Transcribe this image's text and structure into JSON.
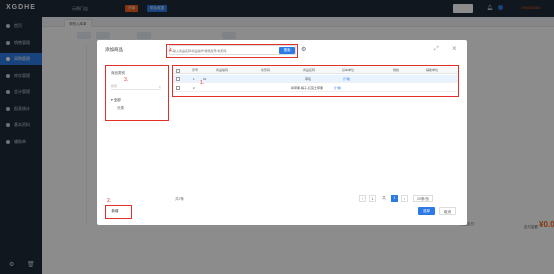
{
  "topbar": {
    "logo": "XGDHE",
    "store": "示例门店",
    "btn_orange": "开单",
    "btn_blue": "前台收银",
    "phone": "1994010000"
  },
  "sidebar": {
    "items": [
      {
        "label": "首页"
      },
      {
        "label": "销售管理"
      },
      {
        "label": "采购管理"
      },
      {
        "label": "库存管理"
      },
      {
        "label": "会计管理"
      },
      {
        "label": "报表统计"
      },
      {
        "label": "基本资料"
      },
      {
        "label": "辅助单"
      }
    ],
    "active_index": 2
  },
  "background": {
    "tab": "采购入库单",
    "total_label": "应付金额",
    "total_value": "¥0.00",
    "cash_label": "现金支付"
  },
  "modal": {
    "title": "添加商品",
    "search_placeholder": "输入商品名称/商品编号/规格型号/条形码",
    "search_button": "搜索",
    "category": {
      "title": "商品类别",
      "search_placeholder": "搜索",
      "root": "全部",
      "child": "分类"
    },
    "table": {
      "headers": [
        "序号",
        "商品编码",
        "条形码",
        "商品名称",
        "基本单位",
        "规格",
        "辅助单位"
      ],
      "rows": [
        {
          "index": "1",
          "code": "01",
          "barcode": "",
          "name": "草莓",
          "unit": "斤/箱",
          "spec": "",
          "aux_unit": ""
        },
        {
          "index": "2",
          "code": "",
          "barcode": "",
          "name": "青苹果-橘子-红富士苹果",
          "unit": "斤/箱",
          "spec": "",
          "aux_unit": ""
        }
      ]
    },
    "footer": {
      "selected": "共2条",
      "pager_prev": "‹",
      "pager_page": "1",
      "pager_next": "›",
      "page_size": "20条/页",
      "add_button": "新增",
      "confirm_button": "选择",
      "cancel_button": "取消"
    }
  },
  "annotations": {
    "n1": "1.",
    "n2": "2.",
    "n3": "3.",
    "n4": "4."
  }
}
